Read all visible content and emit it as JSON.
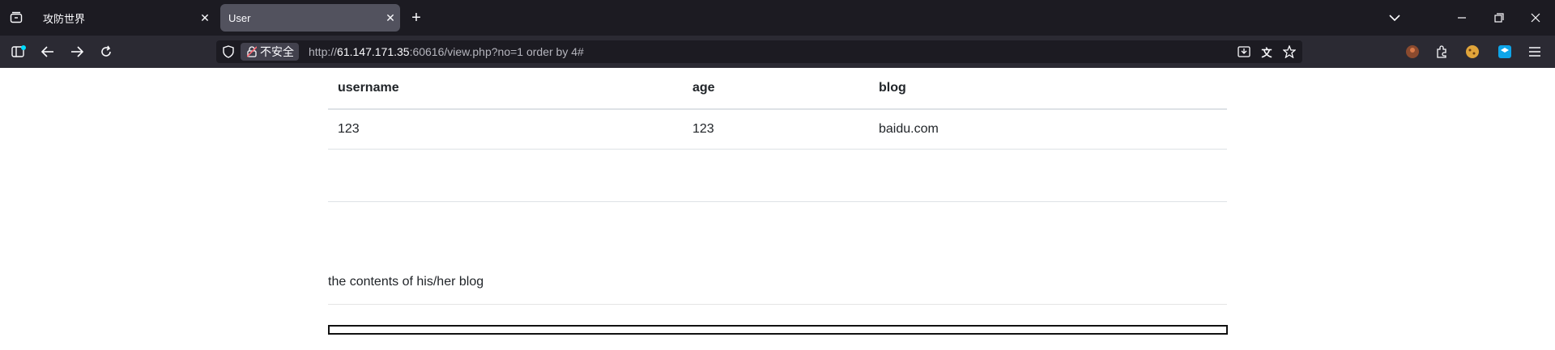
{
  "tabs": [
    {
      "title": "攻防世界",
      "active": false
    },
    {
      "title": "User",
      "active": true
    }
  ],
  "toolbar": {
    "insecure_label": "不安全",
    "url_prefix": "http://",
    "url_host": "61.147.171.35",
    "url_rest": ":60616/view.php?no=1 order by 4#"
  },
  "table": {
    "headers": [
      "username",
      "age",
      "blog"
    ],
    "rows": [
      [
        "123",
        "123",
        "baidu.com"
      ]
    ]
  },
  "blog_section": {
    "title": "the contents of his/her blog"
  },
  "colors": {
    "tabbar": "#1c1b22",
    "active_tab": "#52525e",
    "navbar": "#2b2a33",
    "urlbar": "#1c1b22"
  }
}
